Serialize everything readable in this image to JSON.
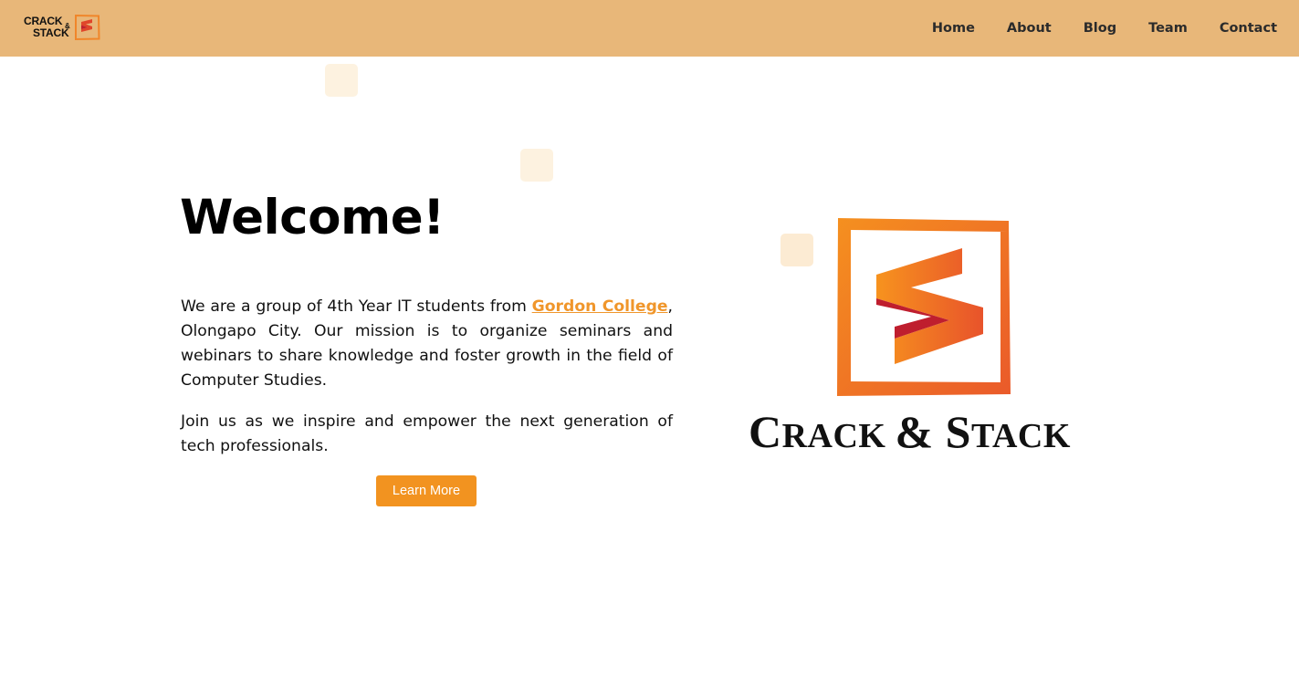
{
  "header": {
    "brand": {
      "line1": "CRACK",
      "amp": "&",
      "line2": "STACK"
    },
    "nav": [
      {
        "label": "Home"
      },
      {
        "label": "About"
      },
      {
        "label": "Blog"
      },
      {
        "label": "Team"
      },
      {
        "label": "Contact"
      }
    ]
  },
  "hero": {
    "title": "Welcome!",
    "paragraph1": {
      "before": "We are a group of 4th Year IT students from ",
      "link": "Gordon College",
      "after": ", Olongapo City. Our mission is to organize seminars and webinars to share knowledge and foster growth in the field of Computer Studies."
    },
    "paragraph2": "Join us as we inspire and empower the next generation of tech professionals.",
    "button_label": "Learn More"
  },
  "logo": {
    "wordmark_part1_cap": "C",
    "wordmark_part1_rest": "RACK ",
    "wordmark_amp": "& ",
    "wordmark_part2_cap": "S",
    "wordmark_part2_rest": "TACK"
  },
  "colors": {
    "header_bg": "#e8b779",
    "accent_orange": "#f29320",
    "logo_red": "#c0202e",
    "link": "#f0962b"
  }
}
